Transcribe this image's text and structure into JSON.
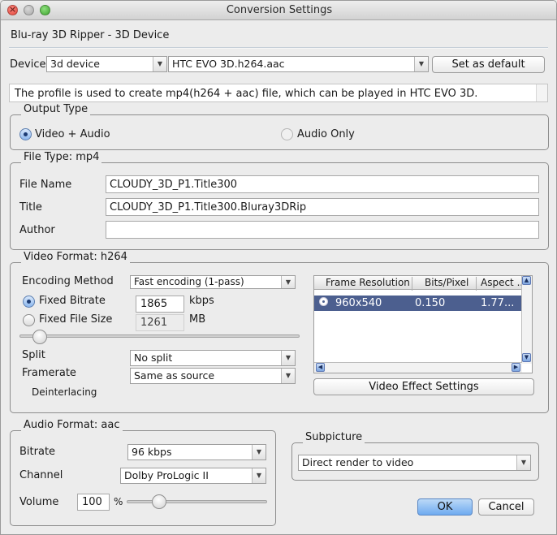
{
  "window": {
    "title": "Conversion Settings"
  },
  "header": {
    "label": "Blu-ray 3D Ripper - 3D Device"
  },
  "device": {
    "label": "Device",
    "category_value": "3d device",
    "profile_value": "HTC EVO 3D.h264.aac",
    "set_default_label": "Set as default"
  },
  "profile_description": "The profile is used to create mp4(h264 + aac) file, which can be played in HTC EVO 3D.",
  "output_type": {
    "title": "Output Type",
    "video_audio_label": "Video + Audio",
    "audio_only_label": "Audio Only",
    "selected": "Video + Audio"
  },
  "file_type": {
    "title": "File Type: mp4",
    "file_name_label": "File Name",
    "file_name_value": "CLOUDY_3D_P1.Title300",
    "title_label": "Title",
    "title_value": "CLOUDY_3D_P1.Title300.Bluray3DRip",
    "author_label": "Author",
    "author_value": ""
  },
  "video_format": {
    "title": "Video Format: h264",
    "encoding_method_label": "Encoding Method",
    "encoding_method_value": "Fast encoding (1-pass)",
    "fixed_bitrate_label": "Fixed Bitrate",
    "fixed_bitrate_value": "1865",
    "fixed_bitrate_unit": "kbps",
    "fixed_file_size_label": "Fixed File Size",
    "fixed_file_size_value": "1261",
    "fixed_file_size_unit": "MB",
    "selected_mode": "Fixed Bitrate",
    "split_label": "Split",
    "split_value": "No split",
    "framerate_label": "Framerate",
    "framerate_value": "Same as source",
    "deinterlacing_label": "Deinterlacing",
    "table": {
      "columns": [
        "Frame Resolution",
        "Bits/Pixel",
        "Aspect ..."
      ],
      "rows": [
        {
          "resolution": "960x540",
          "bits_pixel": "0.150",
          "aspect": "1.77...",
          "selected": true
        }
      ]
    },
    "video_effect_label": "Video Effect Settings"
  },
  "audio_format": {
    "title": "Audio Format: aac",
    "bitrate_label": "Bitrate",
    "bitrate_value": "96 kbps",
    "channel_label": "Channel",
    "channel_value": "Dolby ProLogic II",
    "volume_label": "Volume",
    "volume_value": "100",
    "volume_unit": "%"
  },
  "subpicture": {
    "title": "Subpicture",
    "value": "Direct render to video"
  },
  "buttons": {
    "ok": "OK",
    "cancel": "Cancel"
  },
  "colors": {
    "selection": "#4c5f8f",
    "primary_button": "#6eaaf0"
  }
}
